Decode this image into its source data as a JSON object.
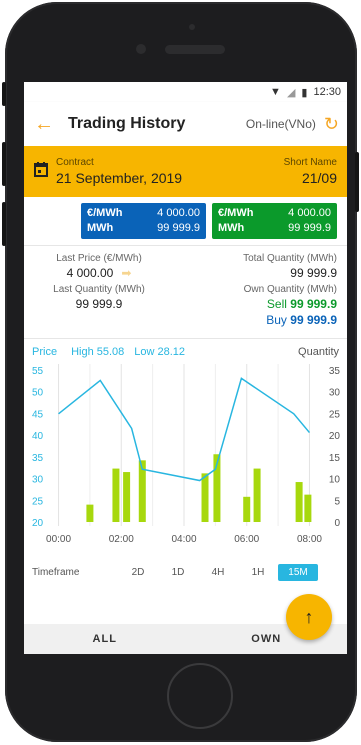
{
  "status": {
    "time": "12:30"
  },
  "appbar": {
    "title": "Trading History",
    "mode": "On-line(VNo)"
  },
  "contract": {
    "label": "Contract",
    "date": "21 September, 2019",
    "short_label": "Short Name",
    "short_value": "21/09"
  },
  "price_boxes": [
    {
      "unit1": "€/MWh",
      "val1": "4 000.00",
      "unit2": "MWh",
      "val2": "99 999.9",
      "color": "#0a63b8"
    },
    {
      "unit1": "€/MWh",
      "val1": "4 000.00",
      "unit2": "MWh",
      "val2": "99 999.9",
      "color": "#0b9a2b"
    }
  ],
  "stats": {
    "last_price_label": "Last Price (€/MWh)",
    "last_price": "4 000.00",
    "total_qty_label": "Total Quantity (MWh)",
    "total_qty": "99 999.9",
    "last_qty_label": "Last Quantity (MWh)",
    "last_qty": "99 999.9",
    "own_qty_label": "Own Quantity (MWh)",
    "sell_label": "Sell",
    "sell_value": "99 999.9",
    "buy_label": "Buy",
    "buy_value": "99 999.9"
  },
  "chart_header": {
    "price": "Price",
    "high": "High 55.08",
    "low": "Low 28.12",
    "quantity": "Quantity"
  },
  "chart_data": {
    "type": "bar",
    "price_ticks": [
      "55",
      "50",
      "45",
      "40",
      "35",
      "30",
      "25",
      "20"
    ],
    "qty_ticks": [
      "35",
      "30",
      "25",
      "20",
      "15",
      "10",
      "5",
      "0"
    ],
    "x_ticks": [
      "00:00",
      "02:00",
      "04:00",
      "06:00",
      "08:00"
    ],
    "price_range": [
      20,
      55
    ],
    "qty_range": [
      0,
      35
    ],
    "time_range": [
      -0.4,
      8.4
    ],
    "bars": [
      {
        "x": 1.0,
        "qty": 4
      },
      {
        "x": 1.83,
        "qty": 12.3
      },
      {
        "x": 2.17,
        "qty": 11.5
      },
      {
        "x": 2.67,
        "qty": 14.2
      },
      {
        "x": 4.67,
        "qty": 11.2
      },
      {
        "x": 5.05,
        "qty": 15.6
      },
      {
        "x": 6.0,
        "qty": 5.8
      },
      {
        "x": 6.33,
        "qty": 12.3
      },
      {
        "x": 7.67,
        "qty": 9.2
      },
      {
        "x": 7.95,
        "qty": 6.3
      }
    ],
    "price_line": [
      {
        "x": 0.0,
        "y": 44.5
      },
      {
        "x": 1.33,
        "y": 52.5
      },
      {
        "x": 2.33,
        "y": 41.0
      },
      {
        "x": 2.67,
        "y": 31.2
      },
      {
        "x": 4.5,
        "y": 28.5
      },
      {
        "x": 5.0,
        "y": 31.2
      },
      {
        "x": 5.83,
        "y": 53.0
      },
      {
        "x": 7.5,
        "y": 44.5
      },
      {
        "x": 8.0,
        "y": 40.0
      }
    ],
    "bar_color": "#a7d80d",
    "line_color": "#28b6e0",
    "grid": true
  },
  "timeframe": {
    "label": "Timeframe",
    "options": [
      "2D",
      "1D",
      "4H",
      "1H",
      "15M"
    ],
    "active": "15M"
  },
  "tabs": {
    "all": "ALL",
    "own": "OWN"
  }
}
